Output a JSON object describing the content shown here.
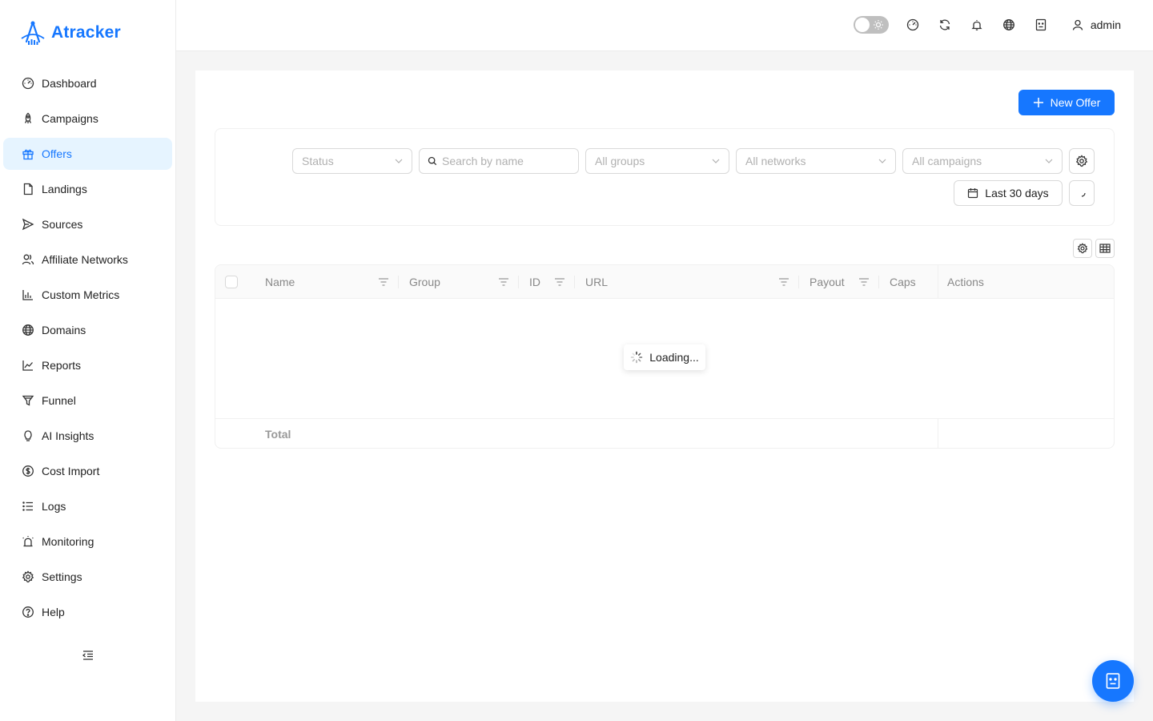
{
  "app": {
    "name": "Atracker",
    "brand_color": "#1677ff"
  },
  "sidebar": {
    "items": [
      {
        "label": "Dashboard",
        "icon": "dashboard-icon"
      },
      {
        "label": "Campaigns",
        "icon": "rocket-icon"
      },
      {
        "label": "Offers",
        "icon": "gift-icon",
        "active": true
      },
      {
        "label": "Landings",
        "icon": "file-icon"
      },
      {
        "label": "Sources",
        "icon": "send-icon"
      },
      {
        "label": "Affiliate Networks",
        "icon": "users-icon"
      },
      {
        "label": "Custom Metrics",
        "icon": "bar-chart-icon"
      },
      {
        "label": "Domains",
        "icon": "globe-icon"
      },
      {
        "label": "Reports",
        "icon": "line-chart-icon"
      },
      {
        "label": "Funnel",
        "icon": "funnel-icon"
      },
      {
        "label": "AI Insights",
        "icon": "bulb-icon"
      },
      {
        "label": "Cost Import",
        "icon": "dollar-icon"
      },
      {
        "label": "Logs",
        "icon": "list-icon"
      },
      {
        "label": "Monitoring",
        "icon": "alarm-icon"
      },
      {
        "label": "Settings",
        "icon": "gear-icon"
      },
      {
        "label": "Help",
        "icon": "question-icon"
      }
    ]
  },
  "header": {
    "user": "admin"
  },
  "toolbar": {
    "new_offer_label": "New Offer"
  },
  "filters": {
    "status_placeholder": "Status",
    "search_placeholder": "Search by name",
    "groups_placeholder": "All groups",
    "networks_placeholder": "All networks",
    "campaigns_placeholder": "All campaigns",
    "date_range": "Last 30 days"
  },
  "table": {
    "columns": [
      "Name",
      "Group",
      "ID",
      "URL",
      "Payout",
      "Caps",
      "Actions"
    ],
    "loading_text": "Loading...",
    "total_label": "Total"
  }
}
